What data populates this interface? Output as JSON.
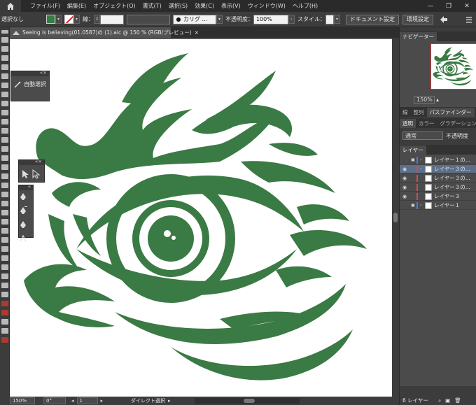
{
  "app": {
    "menus": [
      "ファイル(F)",
      "編集(E)",
      "オブジェクト(O)",
      "書式(T)",
      "選択(S)",
      "効果(C)",
      "表示(V)",
      "ウィンドウ(W)",
      "ヘルプ(H)"
    ],
    "window_controls": [
      "—",
      "❐",
      "✕"
    ]
  },
  "controlbar": {
    "selection_status": "選択なし",
    "stroke_label": "線：",
    "brush_label": "カリグ ...",
    "opacity_label": "不透明度：",
    "opacity_value": "100%",
    "style_label": "スタイル：",
    "document_setup": "ドキュメント設定",
    "preferences": "環境設定",
    "fill_color": "#3a7a44"
  },
  "document": {
    "tab_title": "Seeing is believing(01.0587)の (1).aic @ 150 % (RGB/プレビュー)",
    "close": "×"
  },
  "panels": {
    "auto_select": "自動選択",
    "navigator_tab": "ナビゲーター",
    "nav_zoom": "150%",
    "tabs_row2": [
      "線",
      "整列",
      "パスファインダー"
    ],
    "tabs_row3": [
      "透明",
      "カラー",
      "グラデーション"
    ],
    "blend_mode": "通常",
    "opacity_label": "不透明度",
    "layers_tab": "レイヤー",
    "layers": [
      {
        "name": "レイヤー１の...",
        "lock": true,
        "visible": false,
        "selected": false,
        "color": "#4a7bd4",
        "arrow": "›"
      },
      {
        "name": "レイヤー３の...",
        "lock": false,
        "visible": true,
        "selected": true,
        "color": "#d44a4a",
        "arrow": "›"
      },
      {
        "name": "レイヤー３の...",
        "lock": false,
        "visible": true,
        "selected": false,
        "color": "#d44a4a",
        "arrow": ""
      },
      {
        "name": "レイヤー３の...",
        "lock": false,
        "visible": true,
        "selected": false,
        "color": "#d44a4a",
        "arrow": ""
      },
      {
        "name": "レイヤー３",
        "lock": false,
        "visible": true,
        "selected": false,
        "color": "#d44a4a",
        "arrow": ""
      },
      {
        "name": "レイヤー１",
        "lock": true,
        "visible": false,
        "selected": false,
        "color": "#4a7bd4",
        "arrow": "›"
      }
    ],
    "layers_count": "6 レイヤー"
  },
  "statusbar": {
    "zoom": "150%",
    "rotation": "0°",
    "artboard": "1",
    "tool": "ダイレクト選択"
  },
  "art": {
    "color": "#3a7a44"
  }
}
